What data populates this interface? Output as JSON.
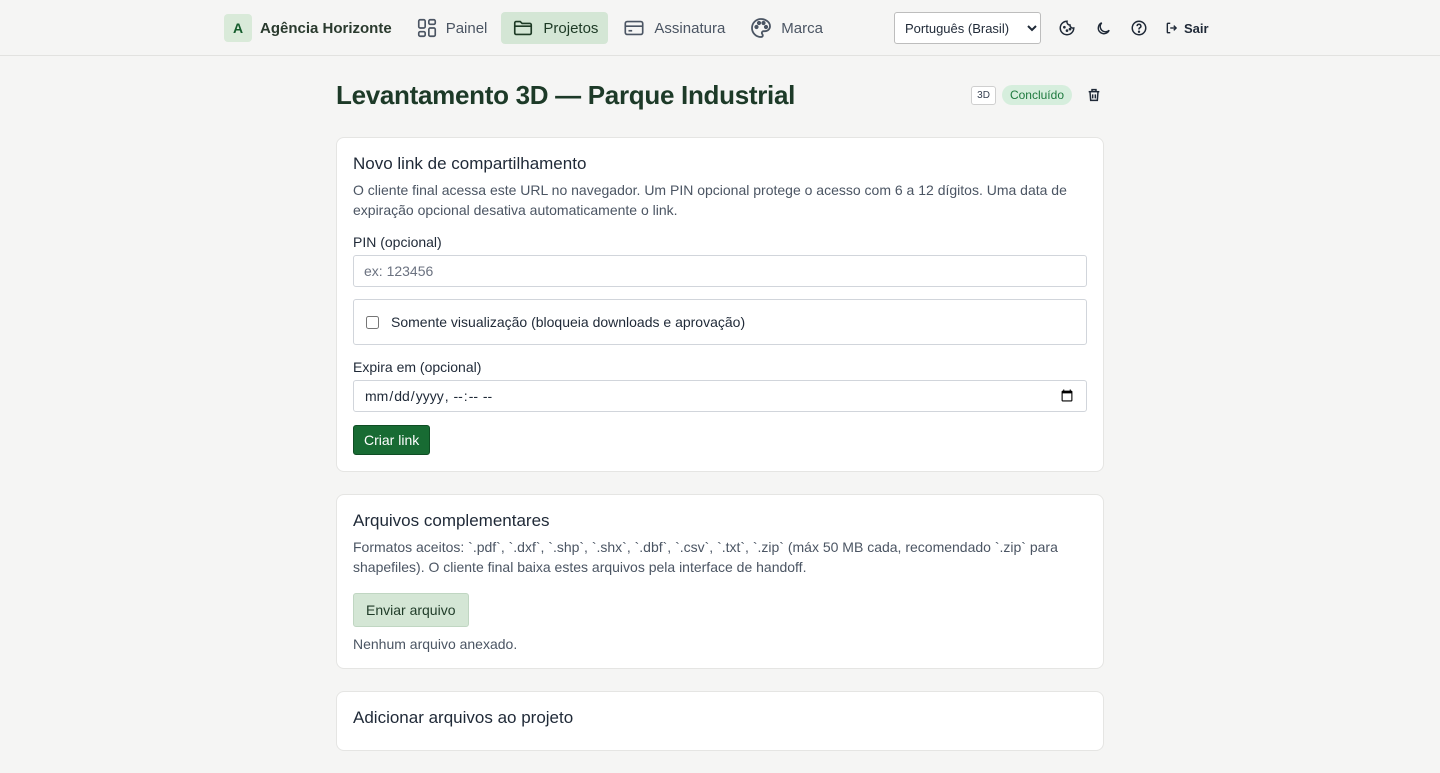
{
  "nav": {
    "brand_letter": "A",
    "brand_name": "Agência Horizonte",
    "items": [
      {
        "label": "Painel",
        "icon": "grid-icon"
      },
      {
        "label": "Projetos",
        "icon": "folder-icon",
        "active": true
      },
      {
        "label": "Assinatura",
        "icon": "credit-card-icon"
      },
      {
        "label": "Marca",
        "icon": "palette-icon"
      }
    ],
    "language": "Português (Brasil)",
    "logout": "Sair"
  },
  "project": {
    "title": "Levantamento 3D — Parque Industrial",
    "type_tag": "3D",
    "status": "Concluído"
  },
  "share": {
    "title": "Novo link de compartilhamento",
    "description": "O cliente final acessa este URL no navegador. Um PIN opcional protege o acesso com 6 a 12 dígitos. Uma data de expiração opcional desativa automaticamente o link.",
    "pin_label": "PIN (opcional)",
    "pin_placeholder": "ex: 123456",
    "view_only_label": "Somente visualização (bloqueia downloads e aprovação)",
    "expires_label": "Expira em (opcional)",
    "create_button": "Criar link"
  },
  "files": {
    "title": "Arquivos complementares",
    "description": "Formatos aceitos: `.pdf`, `.dxf`, `.shp`, `.shx`, `.dbf`, `.csv`, `.txt`, `.zip` (máx 50 MB cada, recomendado `.zip` para shapefiles). O cliente final baixa estes arquivos pela interface de handoff.",
    "upload_button": "Enviar arquivo",
    "empty": "Nenhum arquivo anexado."
  },
  "add_files": {
    "title": "Adicionar arquivos ao projeto"
  },
  "colors": {
    "accent": "#186b33",
    "active_nav": "#d4e6d5",
    "status_bg": "#d6eedd"
  }
}
